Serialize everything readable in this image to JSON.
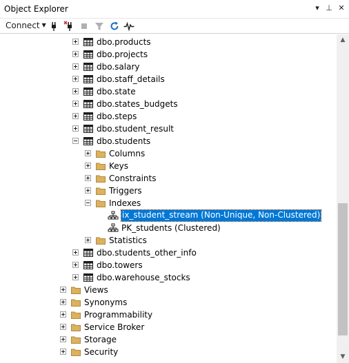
{
  "window": {
    "title": "Object Explorer",
    "dropdown_glyph": "▾",
    "pin_glyph": "⊥",
    "close_glyph": "✕"
  },
  "toolbar": {
    "connect_label": "Connect",
    "icons": [
      "connect-plug-icon",
      "disconnect-plug-icon",
      "stop-icon",
      "filter-icon",
      "refresh-icon",
      "activity-monitor-icon"
    ]
  },
  "colors": {
    "selection": "#0078d7",
    "folder": "#dcb15f",
    "refresh": "#1e6fc6"
  },
  "tree": {
    "items": [
      {
        "label": "dbo.products",
        "icon": "table-icon",
        "expander": "plus"
      },
      {
        "label": "dbo.projects",
        "icon": "table-icon",
        "expander": "plus"
      },
      {
        "label": "dbo.salary",
        "icon": "table-icon",
        "expander": "plus"
      },
      {
        "label": "dbo.staff_details",
        "icon": "table-icon",
        "expander": "plus"
      },
      {
        "label": "dbo.state",
        "icon": "table-icon",
        "expander": "plus"
      },
      {
        "label": "dbo.states_budgets",
        "icon": "table-icon",
        "expander": "plus"
      },
      {
        "label": "dbo.steps",
        "icon": "table-icon",
        "expander": "plus"
      },
      {
        "label": "dbo.student_result",
        "icon": "table-icon",
        "expander": "plus"
      },
      {
        "label": "dbo.students",
        "icon": "table-icon",
        "expander": "minus"
      },
      {
        "label": "Columns",
        "icon": "folder-icon",
        "expander": "plus"
      },
      {
        "label": "Keys",
        "icon": "folder-icon",
        "expander": "plus"
      },
      {
        "label": "Constraints",
        "icon": "folder-icon",
        "expander": "plus"
      },
      {
        "label": "Triggers",
        "icon": "folder-icon",
        "expander": "plus"
      },
      {
        "label": "Indexes",
        "icon": "folder-icon",
        "expander": "minus"
      },
      {
        "label": "ix_student_stream (Non-Unique, Non-Clustered)",
        "icon": "index-icon",
        "expander": "none",
        "selected": true
      },
      {
        "label": "PK_students (Clustered)",
        "icon": "index-icon",
        "expander": "none"
      },
      {
        "label": "Statistics",
        "icon": "folder-icon",
        "expander": "plus"
      },
      {
        "label": "dbo.students_other_info",
        "icon": "table-icon",
        "expander": "plus"
      },
      {
        "label": "dbo.towers",
        "icon": "table-icon",
        "expander": "plus"
      },
      {
        "label": "dbo.warehouse_stocks",
        "icon": "table-icon",
        "expander": "plus"
      },
      {
        "label": "Views",
        "icon": "folder-icon",
        "expander": "plus"
      },
      {
        "label": "Synonyms",
        "icon": "folder-icon",
        "expander": "plus"
      },
      {
        "label": "Programmability",
        "icon": "folder-icon",
        "expander": "plus"
      },
      {
        "label": "Service Broker",
        "icon": "folder-icon",
        "expander": "plus"
      },
      {
        "label": "Storage",
        "icon": "folder-icon",
        "expander": "plus"
      },
      {
        "label": "Security",
        "icon": "folder-icon",
        "expander": "plus"
      }
    ]
  },
  "scrollbar": {
    "up_glyph": "▲",
    "down_glyph": "▼"
  }
}
